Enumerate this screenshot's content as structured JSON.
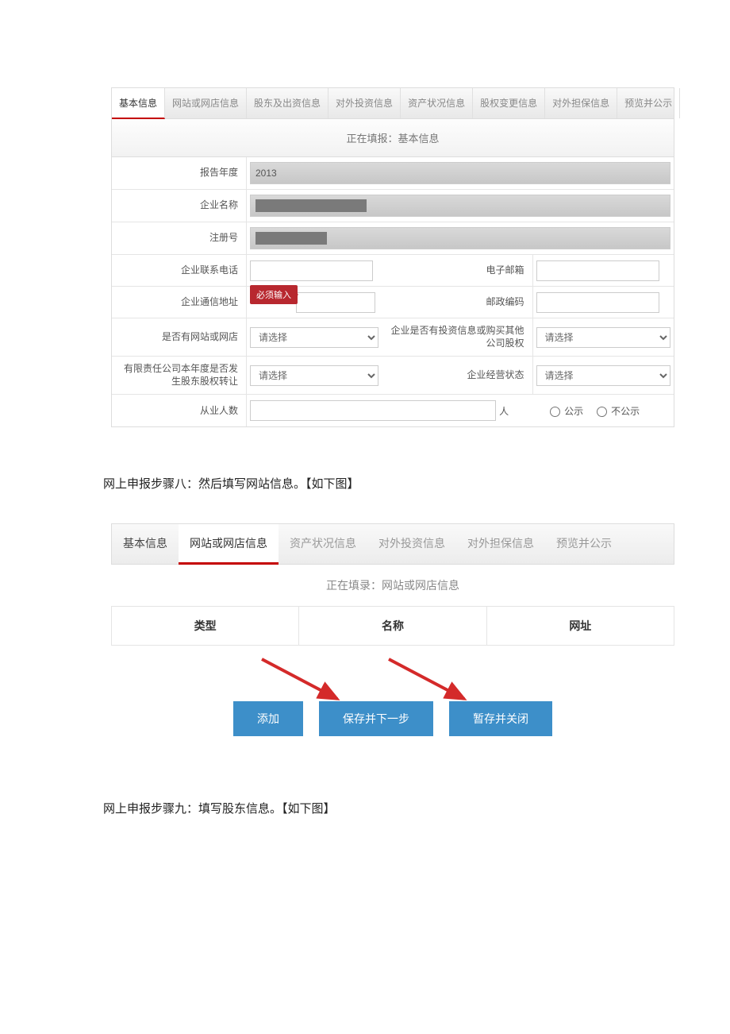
{
  "panel1": {
    "tabs": [
      "基本信息",
      "网站或网店信息",
      "股东及出资信息",
      "对外投资信息",
      "资产状况信息",
      "股权变更信息",
      "对外担保信息",
      "预览并公示"
    ],
    "banner": "正在填报：基本信息",
    "labels": {
      "report_year": "报告年度",
      "company_name": "企业名称",
      "reg_no": "注册号",
      "phone": "企业联系电话",
      "email": "电子邮箱",
      "address": "企业通信地址",
      "postal": "邮政编码",
      "has_website": "是否有网站或网店",
      "has_invest": "企业是否有投资信息或购买其他公司股权",
      "equity_transfer": "有限责任公司本年度是否发生股东股权转让",
      "op_status": "企业经营状态",
      "employees": "从业人数"
    },
    "values": {
      "report_year": "2013",
      "select_placeholder": "请选择",
      "required_tip": "必须输入",
      "unit_people": "人",
      "radio_public": "公示",
      "radio_private": "不公示"
    }
  },
  "doc": {
    "step8": "网上申报步骤八：然后填写网站信息。【如下图】",
    "step9": "网上申报步骤九：填写股东信息。【如下图】"
  },
  "panel2": {
    "tabs": [
      "基本信息",
      "网站或网店信息",
      "资产状况信息",
      "对外投资信息",
      "对外担保信息",
      "预览并公示"
    ],
    "banner": "正在填录：网站或网店信息",
    "headers": [
      "类型",
      "名称",
      "网址"
    ],
    "buttons": {
      "add": "添加",
      "save_next": "保存并下一步",
      "pause_close": "暂存并关闭"
    }
  }
}
